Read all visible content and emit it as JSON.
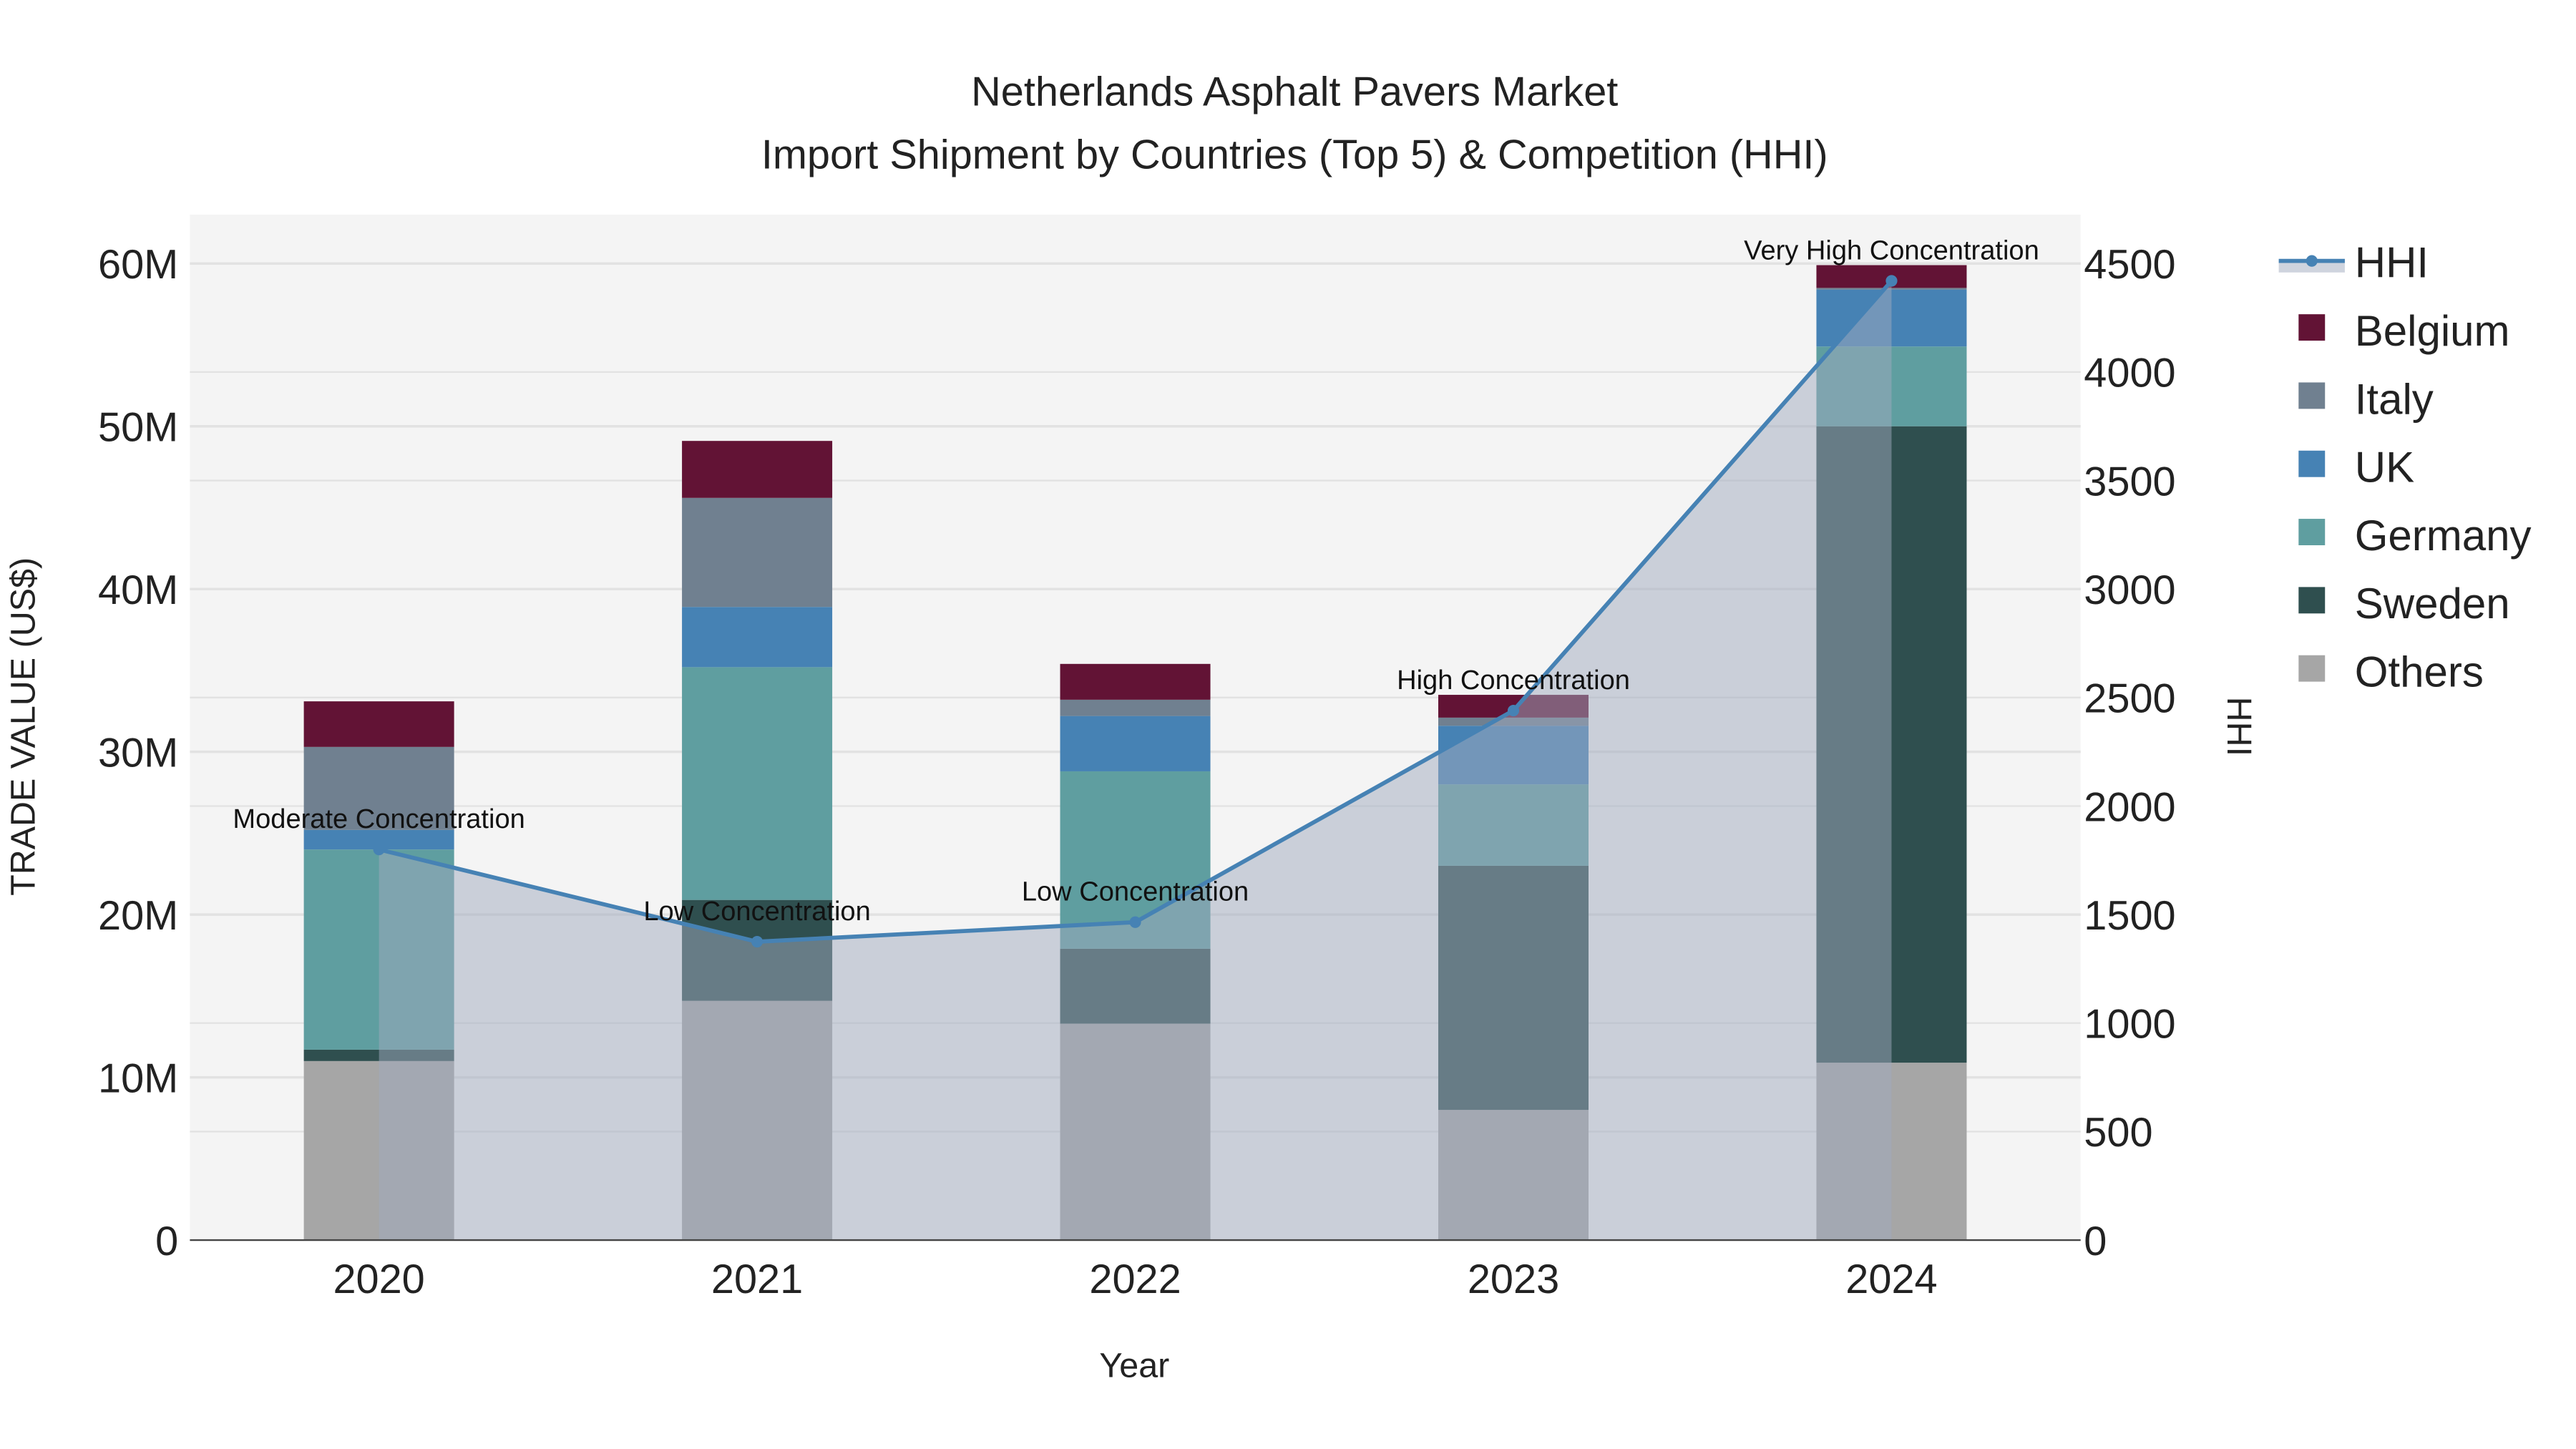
{
  "chart_data": {
    "type": "bar",
    "title": "Netherlands Asphalt Pavers Market",
    "subtitle": "Import Shipment by Countries (Top 5) & Competition (HHI)",
    "xlabel": "Year",
    "ylabel": "TRADE VALUE (US$)",
    "y2label": "HHI",
    "categories": [
      "2020",
      "2021",
      "2022",
      "2023",
      "2024"
    ],
    "ylim": [
      0,
      63
    ],
    "yticks": [
      0,
      10,
      20,
      30,
      40,
      50,
      60
    ],
    "ytick_labels": [
      "0",
      "10M",
      "20M",
      "30M",
      "40M",
      "50M",
      "60M"
    ],
    "y2lim": [
      0,
      4725
    ],
    "y2ticks": [
      0,
      500,
      1000,
      1500,
      2000,
      2500,
      3000,
      3500,
      4000,
      4500
    ],
    "y2tick_labels": [
      "0",
      "500",
      "1000",
      "1500",
      "2000",
      "2500",
      "3000",
      "3500",
      "4000",
      "4500"
    ],
    "grid": true,
    "legend_position": "right",
    "value_units": "million US$",
    "series": [
      {
        "name": "Others",
        "color": "#a6a6a6",
        "values": [
          11.0,
          14.7,
          13.3,
          8.0,
          10.9
        ]
      },
      {
        "name": "Sweden",
        "color": "#2f4f4f",
        "values": [
          0.7,
          6.2,
          4.6,
          15.0,
          39.1
        ]
      },
      {
        "name": "Germany",
        "color": "#5f9ea0",
        "values": [
          12.3,
          14.3,
          10.9,
          5.0,
          4.9
        ]
      },
      {
        "name": "UK",
        "color": "#4682b4",
        "values": [
          1.2,
          3.7,
          3.4,
          3.6,
          3.5
        ]
      },
      {
        "name": "Italy",
        "color": "#708090",
        "values": [
          5.1,
          6.7,
          1.0,
          0.5,
          0.1
        ]
      },
      {
        "name": "Belgium",
        "color": "#621335",
        "values": [
          2.8,
          3.5,
          2.2,
          1.4,
          1.4
        ]
      }
    ],
    "line": {
      "name": "HHI",
      "color": "#4682b4",
      "values": [
        1800,
        1375,
        1465,
        2440,
        4420
      ],
      "annotations": [
        "Moderate Concentration",
        "Low Concentration",
        "Low Concentration",
        "High Concentration",
        "Very High Concentration"
      ]
    },
    "legend_order": [
      "HHI",
      "Belgium",
      "Italy",
      "UK",
      "Germany",
      "Sweden",
      "Others"
    ]
  }
}
